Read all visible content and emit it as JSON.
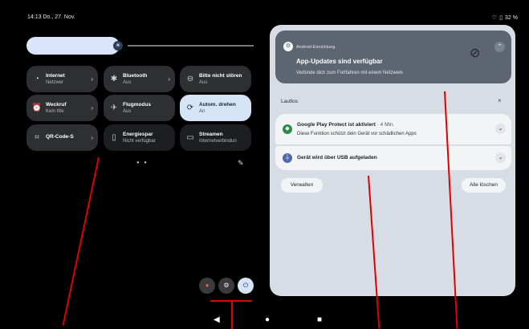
{
  "status_bar": {
    "time_date": "14:13 Do., 27. Nov.",
    "battery": "32 %"
  },
  "quick_settings": {
    "brightness_level": 0.41,
    "tiles": [
      {
        "title": "Internet",
        "subtitle": "Netzwer",
        "icon": "wifi-icon",
        "has_chevron": true,
        "state": "normal"
      },
      {
        "title": "Bluetooth",
        "subtitle": "Aus",
        "icon": "bluetooth-icon",
        "has_chevron": true,
        "state": "normal"
      },
      {
        "title": "Bitte nicht stören",
        "subtitle": "Aus",
        "icon": "dnd-icon",
        "has_chevron": false,
        "state": "normal"
      },
      {
        "title": "Weckruf",
        "subtitle": "Kein We",
        "icon": "alarm-icon",
        "has_chevron": true,
        "state": "normal"
      },
      {
        "title": "Flugmodus",
        "subtitle": "Aus",
        "icon": "airplane-icon",
        "has_chevron": false,
        "state": "normal"
      },
      {
        "title": "Autom. drehen",
        "subtitle": "An",
        "icon": "rotate-icon",
        "has_chevron": false,
        "state": "on"
      },
      {
        "title": "QR-Code-S",
        "subtitle": "",
        "icon": "qr-icon",
        "has_chevron": true,
        "state": "normal"
      },
      {
        "title": "Energiespar",
        "subtitle": "Nicht verfügbar",
        "icon": "battery-saver-icon",
        "has_chevron": false,
        "state": "off"
      },
      {
        "title": "Streamen",
        "subtitle": "Internetverbindun",
        "icon": "cast-icon",
        "has_chevron": false,
        "state": "off"
      }
    ],
    "page_dots": "● ●"
  },
  "notifications": {
    "top_card": {
      "app": "Android-Einrichtung",
      "title": "App-Updates sind verfügbar",
      "body": "Verbinde dich zum Fortfahren mit einem Netzwerk"
    },
    "section_title": "Lautlos",
    "section_close": "×",
    "items": [
      {
        "title": "Google Play Protect ist aktiviert",
        "time": " · 4 Min.",
        "body": "Diese Funktion schützt dein Gerät vor schädlichen Apps"
      },
      {
        "title": "Gerät wird über USB aufgeladen"
      }
    ],
    "manage_label": "Verwalten",
    "clear_all_label": "Alle löschen"
  },
  "colors": {
    "accent": "#d6e4f8",
    "panel": "#d7dde4",
    "annotation": "#e00000"
  }
}
